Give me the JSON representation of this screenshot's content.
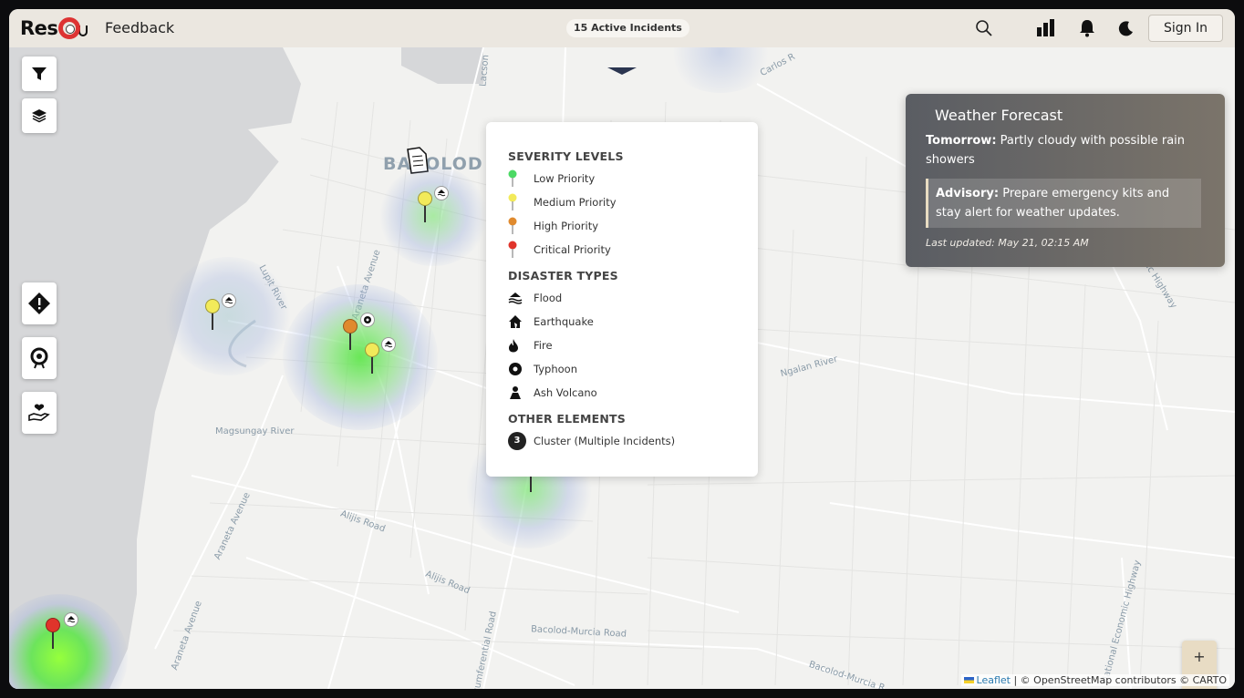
{
  "header": {
    "logo_text": "Res",
    "feedback_link": "Feedback",
    "active_incidents": "15 Active Incidents",
    "sign_in": "Sign In",
    "icons": [
      "search-icon",
      "chart-icon",
      "bell-icon",
      "moon-icon"
    ]
  },
  "map": {
    "city_label": "BACOLOD",
    "street_labels": {
      "lupit_river": "Lupit River",
      "araneta_avenue": "Araneta Avenue",
      "magsungay_river": "Magsungay River",
      "araneta_avenue_2": "Araneta Avenue",
      "araneta_avenue_3": "Araneta Avenue",
      "alijis_road": "Alijis Road",
      "alijis_road_2": "Alijis Road",
      "bacolod_murcia_road": "Bacolod-Murcia Road",
      "ngalan_river": "Ngalan River",
      "economic_highway": "Economic Highway",
      "circumferential_road": "Circumferential Road",
      "carlos": "Carlos R",
      "lacson": "Lacson",
      "bacolod_murcia_road_2": "Bacolod-Murcia R",
      "national_economic_highway": "National Economic Highway"
    },
    "left_controls": [
      "filter-icon",
      "layers-icon",
      "alert-icon",
      "lifebuoy-icon",
      "helping-hand-icon"
    ],
    "markers": [
      {
        "severity": "medium",
        "type": "flood"
      },
      {
        "severity": "medium",
        "type": "flood"
      },
      {
        "severity": "high",
        "type": "typhoon"
      },
      {
        "severity": "medium",
        "type": "flood"
      },
      {
        "severity": "medium",
        "type": "typhoon"
      },
      {
        "severity": "critical",
        "type": "flood"
      }
    ],
    "colors": {
      "low": "#4cd964",
      "medium": "#f2ea5a",
      "high": "#e08a2e",
      "critical": "#e0342b"
    }
  },
  "legend": {
    "severity_title": "SEVERITY LEVELS",
    "severity": [
      "Low Priority",
      "Medium Priority",
      "High Priority",
      "Critical Priority"
    ],
    "types_title": "DISASTER TYPES",
    "types": [
      "Flood",
      "Earthquake",
      "Fire",
      "Typhoon",
      "Ash Volcano"
    ],
    "other_title": "OTHER ELEMENTS",
    "cluster_count": "3",
    "cluster_label": "Cluster (Multiple Incidents)"
  },
  "weather": {
    "title": "Weather Forecast",
    "tomorrow_label": "Tomorrow:",
    "tomorrow_text": "Partly cloudy with possible rain showers",
    "advisory_label": "Advisory:",
    "advisory_text": "Prepare emergency kits and stay alert for weather updates.",
    "updated": "Last updated: May 21, 02:15 AM"
  },
  "zoom": {
    "in": "+",
    "out": ""
  },
  "attribution": {
    "leaflet": "Leaflet",
    "rest": " | © OpenStreetMap contributors © CARTO"
  }
}
